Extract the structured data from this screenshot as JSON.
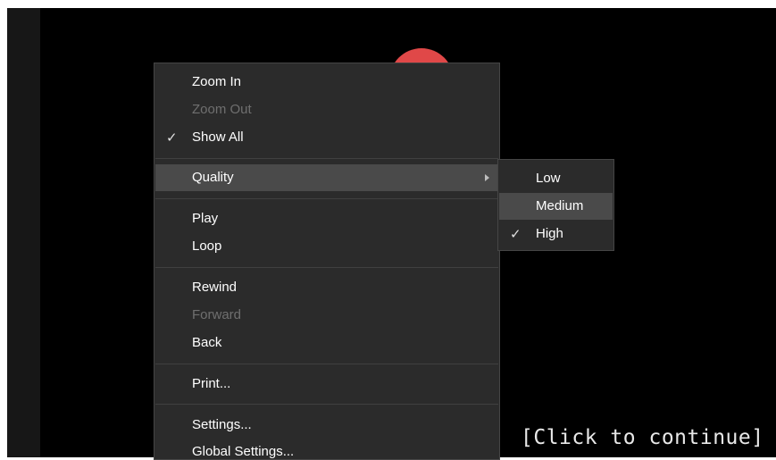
{
  "context_menu": {
    "items": [
      {
        "label": "Zoom In"
      },
      {
        "label": "Zoom Out"
      },
      {
        "label": "Show All"
      },
      {
        "label": "Quality"
      },
      {
        "label": "Play"
      },
      {
        "label": "Loop"
      },
      {
        "label": "Rewind"
      },
      {
        "label": "Forward"
      },
      {
        "label": "Back"
      },
      {
        "label": "Print..."
      },
      {
        "label": "Settings..."
      },
      {
        "label": "Global Settings..."
      }
    ],
    "check_glyph": "✓"
  },
  "quality_submenu": {
    "items": [
      {
        "label": "Low"
      },
      {
        "label": "Medium"
      },
      {
        "label": "High"
      }
    ]
  },
  "prompt": {
    "text": "[Click to continue]"
  },
  "colors": {
    "menu_bg": "#2b2b2b",
    "highlight": "#4a4a4a",
    "disabled_text": "#6f6f6f",
    "accent_shape": "#e04848"
  }
}
